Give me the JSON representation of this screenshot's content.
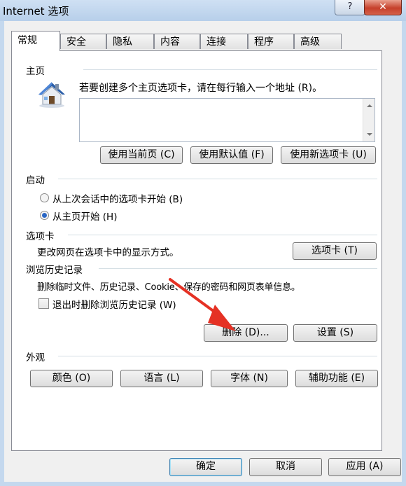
{
  "window": {
    "title": "Internet 选项",
    "help_label": "?",
    "close_label": "✕"
  },
  "tabs": [
    "常规",
    "安全",
    "隐私",
    "内容",
    "连接",
    "程序",
    "高级"
  ],
  "active_tab": "常规",
  "home": {
    "heading": "主页",
    "instructions": "若要创建多个主页选项卡，请在每行输入一个地址 (R)。",
    "addresses_value": "",
    "icon": "house-icon",
    "use_current_label": "使用当前页 (C)",
    "use_default_label": "使用默认值 (F)",
    "use_new_tab_label": "使用新选项卡 (U)"
  },
  "startup": {
    "heading": "启动",
    "option_last_session": "从上次会话中的选项卡开始 (B)",
    "option_home": "从主页开始 (H)",
    "selected": "option_home"
  },
  "tabs_section": {
    "heading": "选项卡",
    "description": "更改网页在选项卡中的显示方式。",
    "button_label": "选项卡 (T)"
  },
  "history": {
    "heading": "浏览历史记录",
    "description": "删除临时文件、历史记录、Cookie、保存的密码和网页表单信息。",
    "checkbox_label": "退出时删除浏览历史记录 (W)",
    "checkbox_checked": false,
    "delete_label": "删除 (D)...",
    "settings_label": "设置 (S)"
  },
  "appearance": {
    "heading": "外观",
    "colors_label": "颜色 (O)",
    "languages_label": "语言 (L)",
    "fonts_label": "字体 (N)",
    "accessibility_label": "辅助功能 (E)"
  },
  "footer": {
    "ok_label": "确定",
    "cancel_label": "取消",
    "apply_label": "应用 (A)"
  },
  "colors": {
    "titlebar": "#bfd4ee",
    "close_button": "#c6402b",
    "annotation_arrow": "#e53124",
    "radio_dot": "#2a66c4"
  }
}
